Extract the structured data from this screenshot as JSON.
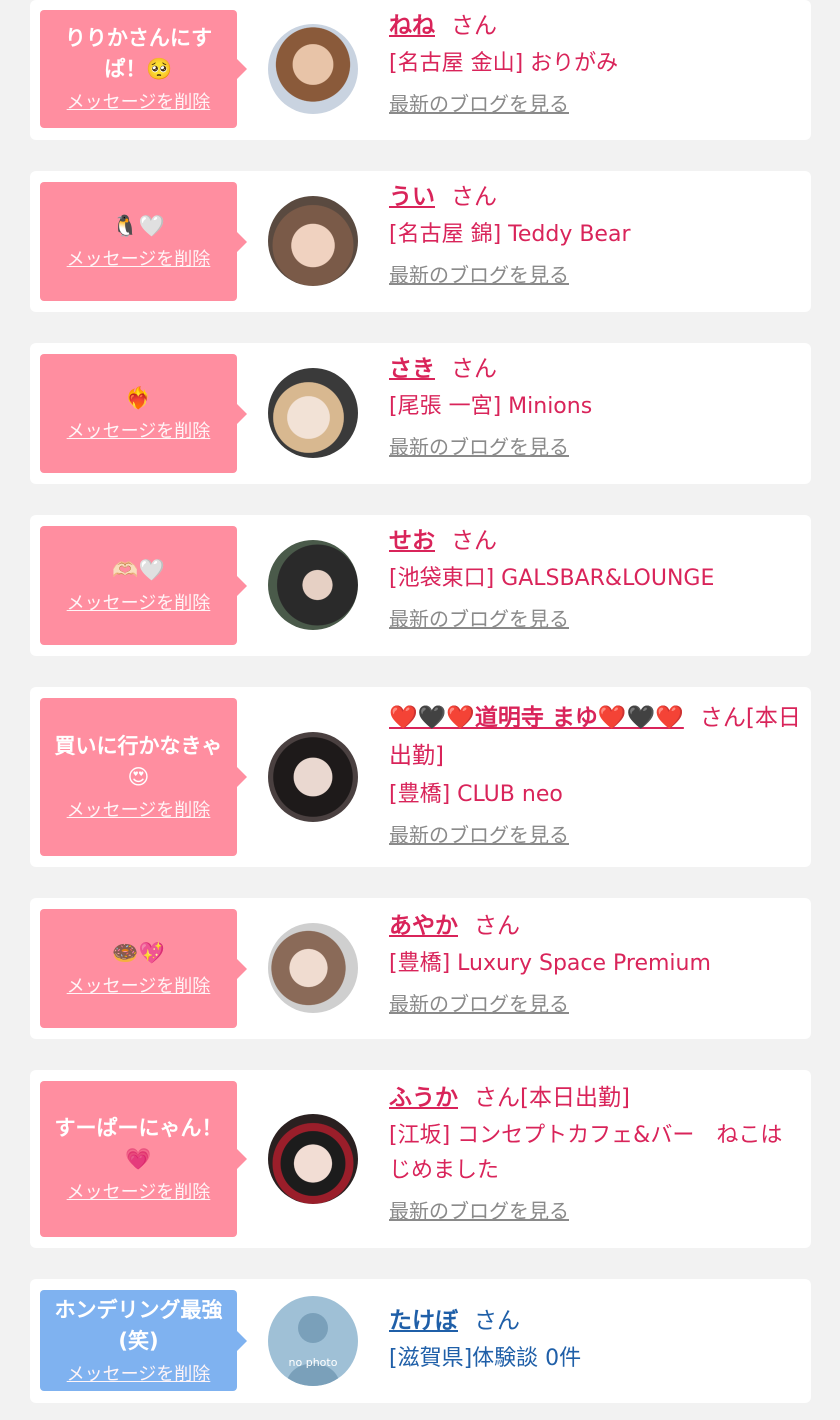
{
  "entries": [
    {
      "message": "りりかさんにすぱ！🥺",
      "delete_label": "メッセージを削除",
      "name": "ねね",
      "suffix": "さん",
      "shop": "[名古屋 金山] おりがみ",
      "blog_link": "最新のブログを見る"
    },
    {
      "message": "🐧🤍",
      "delete_label": "メッセージを削除",
      "name": "うい",
      "suffix": "さん",
      "shop": "[名古屋 錦] Teddy Bear",
      "blog_link": "最新のブログを見る"
    },
    {
      "message": "❤️‍🔥",
      "delete_label": "メッセージを削除",
      "name": "さき",
      "suffix": "さん",
      "shop": "[尾張 一宮] Minions",
      "blog_link": "最新のブログを見る"
    },
    {
      "message": "🫶🏻🤍",
      "delete_label": "メッセージを削除",
      "name": "せお",
      "suffix": "さん",
      "shop": "[池袋東口] GALSBAR&LOUNGE",
      "blog_link": "最新のブログを見る"
    },
    {
      "message": "買いに行かなきゃ😍",
      "delete_label": "メッセージを削除",
      "name": "❤️🖤❤️道明寺 まゆ❤️🖤❤️",
      "suffix": "さん[本日出勤]",
      "shop": "[豊橋] CLUB neo",
      "blog_link": "最新のブログを見る"
    },
    {
      "message": "🍩💖",
      "delete_label": "メッセージを削除",
      "name": "あやか",
      "suffix": "さん",
      "shop": "[豊橋] Luxury Space Premium",
      "blog_link": "最新のブログを見る"
    },
    {
      "message": "すーぱーにゃん！💗",
      "delete_label": "メッセージを削除",
      "name": "ふうか",
      "suffix": "さん[本日出勤]",
      "shop": "[江坂] コンセプトカフェ&バー　ねこはじめました",
      "blog_link": "最新のブログを見る"
    },
    {
      "message": "ホンデリング最強(笑)",
      "delete_label": "メッセージを削除",
      "name": "たけぼ",
      "suffix": "さん",
      "shop": "[滋賀県]体験談 0件",
      "avatar_text": "no photo"
    }
  ],
  "colors": {
    "pink_bubble": "#ff8ea0",
    "blue_bubble": "#7fb2f0",
    "name_pink": "#d9245a",
    "name_blue": "#1f5fa8",
    "background": "#f2f2f2"
  }
}
